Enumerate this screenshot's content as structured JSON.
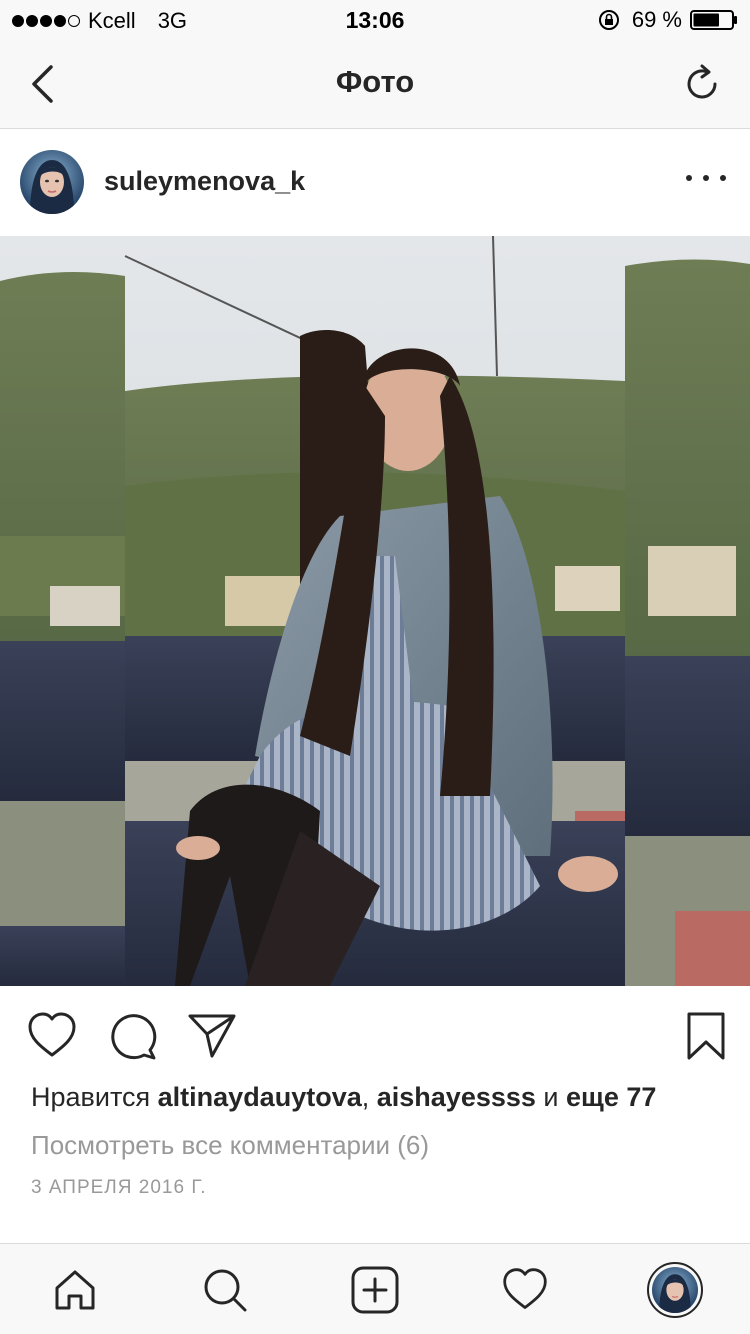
{
  "status_bar": {
    "carrier": "Kcell",
    "network": "3G",
    "time": "13:06",
    "battery": "69 %",
    "battery_level": 0.69
  },
  "nav": {
    "title": "Фото",
    "back_icon": "chevron-left-icon",
    "refresh_icon": "refresh-icon"
  },
  "post": {
    "username": "suleymenova_k",
    "likes_prefix": "Нравится",
    "liker_1": "altinaydauytova",
    "separator": ",",
    "liker_2": "aishayessss",
    "and_word": "и",
    "more_likes": "еще 77",
    "view_comments": "Посмотреть все комментарии (6)",
    "date": "3 АПРЕЛЯ 2016 Г."
  },
  "actions": [
    "heart-icon",
    "comment-icon",
    "send-icon",
    "bookmark-icon"
  ],
  "tab_bar": [
    "home-icon",
    "search-icon",
    "add-icon",
    "heart-icon",
    "profile-avatar"
  ],
  "colors": {
    "text": "#262626",
    "muted": "#999999",
    "bar_bg": "#f8f8f8",
    "divider": "#dbdbdb"
  }
}
